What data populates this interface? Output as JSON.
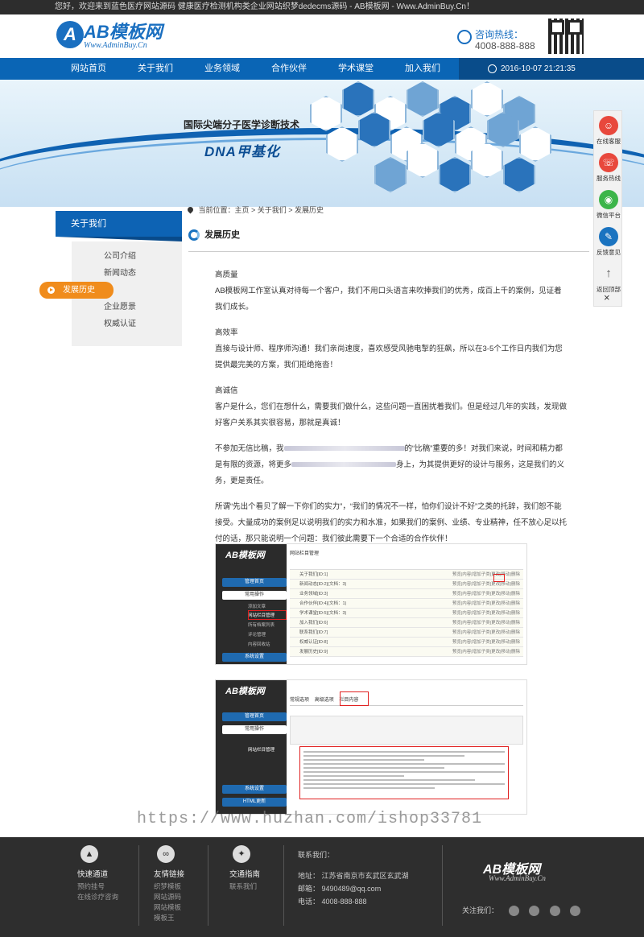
{
  "topbar": {
    "text": "您好，欢迎来到蓝色医疗网站源码 健康医疗检测机构类企业网站织梦dedecms源码 - AB模板网 - Www.AdminBuy.Cn！"
  },
  "header": {
    "logo_mark": "A",
    "logo_text": "AB模板网",
    "logo_sub": "Www.AdminBuy.Cn",
    "hotline_label": "咨询热线：",
    "hotline_number": "4008-888-888"
  },
  "nav": {
    "items": [
      {
        "label": "网站首页"
      },
      {
        "label": "关于我们"
      },
      {
        "label": "业务领域"
      },
      {
        "label": "合作伙伴"
      },
      {
        "label": "学术课堂"
      },
      {
        "label": "加入我们"
      }
    ],
    "datetime": "2016-10-07 21:21:35"
  },
  "banner": {
    "title": "国际尖端分子医学诊断技术",
    "subtitle": "DNA甲基化"
  },
  "sidebar": {
    "heading": "关于我们",
    "items": [
      {
        "label": "公司介绍"
      },
      {
        "label": "新闻动态"
      },
      {
        "label": "发展历史"
      },
      {
        "label": "企业愿景"
      },
      {
        "label": "权威认证"
      }
    ]
  },
  "breadcrumb": {
    "text": "当前位置：主页 > 关于我们 > 发展历史"
  },
  "page_title": "发展历史",
  "content": {
    "h1": "高质量",
    "p1": "AB模板网工作室认真对待每一个客户，我们不用口头语言来吹捧我们的优秀，成百上千的案例，见证着我们成长。",
    "h2": "高效率",
    "p2": "直接与设计师、程序师沟通！我们亲尚速度，喜欢感受风驰电掣的狂飙，所以在3-5个工作日内我们为您提供最完美的方案，我们拒绝拖沓！",
    "h3": "高诚信",
    "p3": "客户是什么，您们在想什么，需要我们做什么，这些问题一直困扰着我们。但是经过几年的实践，发现做好客户关系其实很容易，那就是真诚！",
    "p4a": "不参加无信比稿，我",
    "p4b": "的“比稿”重要的多！对我们来说，时间和精力都是有限的资源，将更多",
    "p4c": "身上，为其提供更好的设计与服务，这是我们的义务，更是责任。",
    "p5": "所谓“先出个看贝了解一下你们的实力”，“我们的情况不一样，怕你们设计不好”之类的托辞，我们恕不能接受。大量成功的案例足以说明我们的实力和水准，如果我们的案例、业绩、专业精神，任不放心足以托付的话，那只能说明一个问题：我们彼此需要下一个合适的合作伙伴！"
  },
  "shot1": {
    "logo": "AB模板网",
    "manage": "管理首页",
    "common": "常用操作",
    "add": "添加文章",
    "column": "网站栏目管理",
    "list": "所有档案列表",
    "comment": "评论管理",
    "content": "内容回收站",
    "settings": "系统设置",
    "tab": "网站栏目管理",
    "rows": [
      "关于我们[ID:1]",
      "新闻动态[ID:2](文档：3)",
      "业务领域[ID:3]",
      "合作伙伴[ID:4](文档：1)",
      "学术课堂[ID:5](文档：3)",
      "加入我们[ID:6]",
      "联系我们[ID:7]",
      "权威认证[ID:8]",
      "发展历史[ID:9]"
    ],
    "row_action": "预览|内容|增加子类|更改|移动|删除"
  },
  "shot2": {
    "logo": "AB模板网",
    "manage": "管理首页",
    "common": "常用操作",
    "column": "网站栏目管理",
    "settings": "系统设置",
    "html": "HTML更新",
    "tabs": [
      "常规选项",
      "高级选项",
      "栏目内容"
    ]
  },
  "watermark": "https://www.huzhan.com/ishop33781",
  "float_bar": {
    "items": [
      {
        "label": "在线客服"
      },
      {
        "label": "服务热线"
      },
      {
        "label": "微信平台"
      },
      {
        "label": "反馈意见"
      },
      {
        "label": "返回顶部"
      }
    ],
    "close": "×"
  },
  "footer": {
    "col1": {
      "title": "快速通道",
      "links": [
        "预约挂号",
        "在线诊疗咨询"
      ]
    },
    "col2": {
      "title": "友情链接",
      "links": [
        "织梦模板",
        "网站源码",
        "网站模板",
        "模板王"
      ]
    },
    "col3": {
      "title": "交通指南",
      "links": [
        "联系我们"
      ]
    },
    "contact_title": "联系我们：",
    "address": "地址：  江苏省南京市玄武区玄武湖",
    "email": "邮箱：  9490489@qq.com",
    "phone": "电话：  4008-888-888",
    "logo": "AB模板网",
    "logo_sub": "Www.AdminBuy.Cn",
    "follow": "关注我们："
  }
}
